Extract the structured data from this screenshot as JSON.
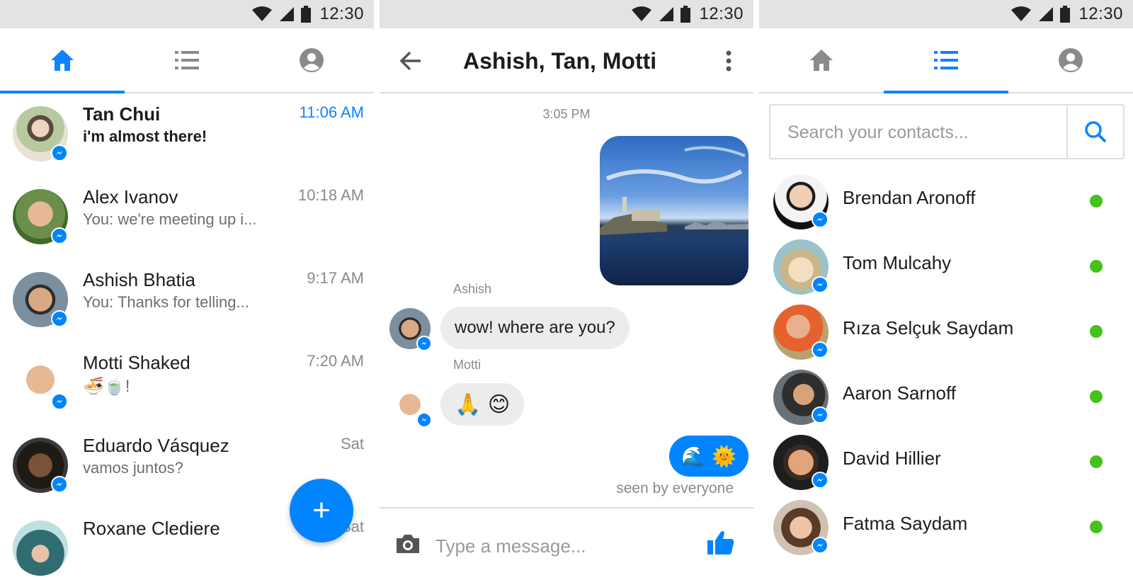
{
  "status_bar": {
    "time": "12:30"
  },
  "inbox": {
    "conversations": [
      {
        "name": "Tan Chui",
        "preview": "i'm almost there!",
        "time": "11:06 AM",
        "unread": true
      },
      {
        "name": "Alex Ivanov",
        "preview": "You: we're meeting up i...",
        "time": "10:18 AM"
      },
      {
        "name": "Ashish Bhatia",
        "preview": "You: Thanks for telling...",
        "time": "9:17 AM"
      },
      {
        "name": "Motti Shaked",
        "preview": "🍜🍵!",
        "time": "7:20 AM"
      },
      {
        "name": "Eduardo Vásquez",
        "preview": "vamos juntos?",
        "time": "Sat"
      },
      {
        "name": "Roxane Clediere",
        "preview": "",
        "time": "Sat"
      }
    ],
    "fab_label": "+"
  },
  "chat": {
    "title": "Ashish, Tan, Motti",
    "timestamp": "3:05 PM",
    "messages": [
      {
        "sender": "Ashish",
        "text": "wow! where are you?"
      },
      {
        "sender": "Motti",
        "text": "🙏 😊"
      }
    ],
    "my_reply": "🌊 🌞",
    "seen_text": "seen by everyone",
    "composer_placeholder": "Type a message..."
  },
  "contacts": {
    "search_placeholder": "Search your contacts...",
    "list": [
      {
        "name": "Brendan Aronoff",
        "online": true
      },
      {
        "name": "Tom Mulcahy",
        "online": true
      },
      {
        "name": "Rıza Selçuk Saydam",
        "online": true
      },
      {
        "name": "Aaron Sarnoff",
        "online": true
      },
      {
        "name": "David Hillier",
        "online": true
      },
      {
        "name": "Fatma Saydam",
        "online": true
      }
    ]
  },
  "colors": {
    "accent": "#0084ff",
    "online": "#44c21a",
    "statusbar": "#e3e3e3"
  }
}
